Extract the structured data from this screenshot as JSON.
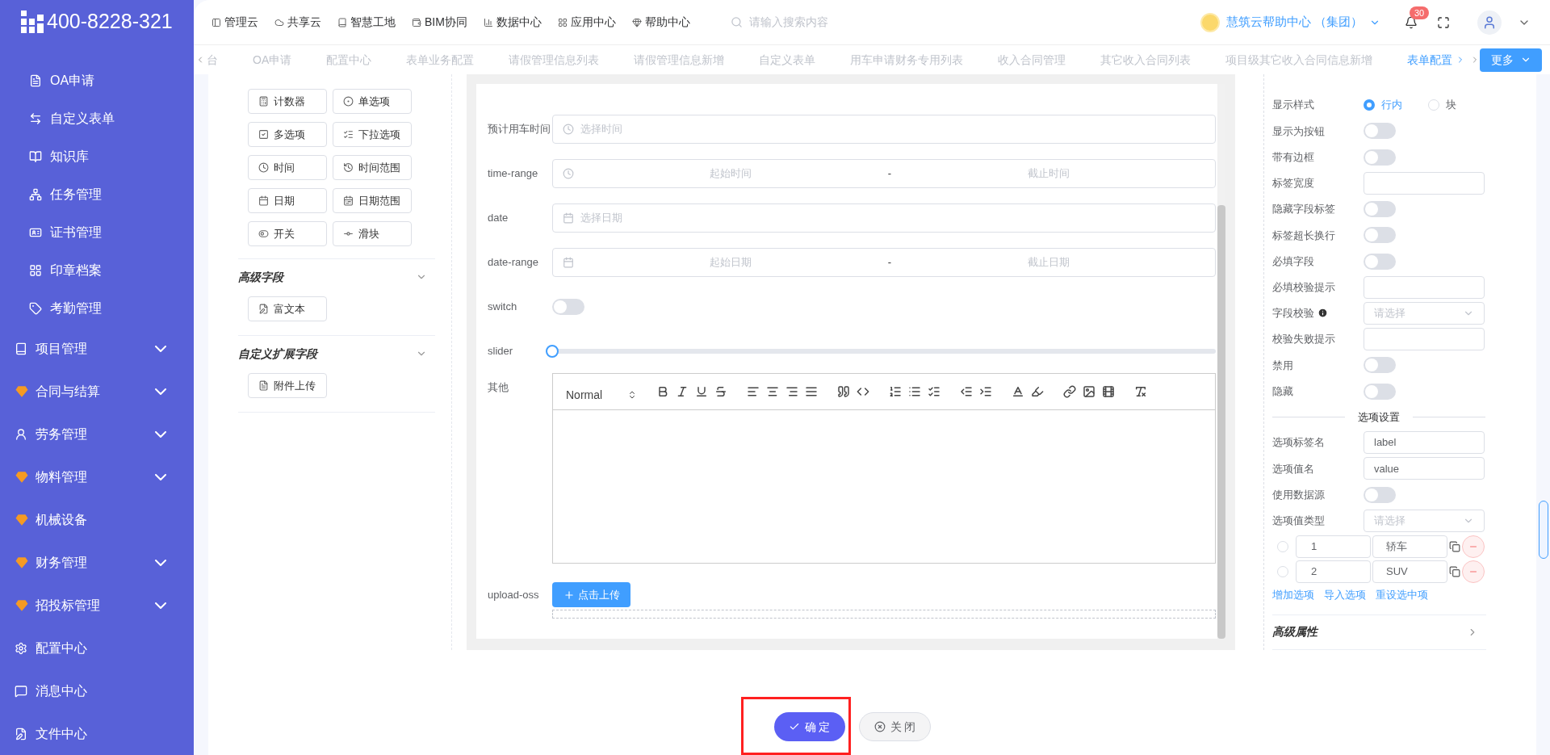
{
  "logo": {
    "text": "400-8228-321"
  },
  "sidebar": {
    "items": [
      {
        "label": "OA申请",
        "kind": "sub",
        "expandable": false
      },
      {
        "label": "自定义表单",
        "kind": "sub",
        "expandable": false
      },
      {
        "label": "知识库",
        "kind": "sub",
        "expandable": false
      },
      {
        "label": "任务管理",
        "kind": "sub",
        "expandable": false
      },
      {
        "label": "证书管理",
        "kind": "sub",
        "expandable": false
      },
      {
        "label": "印章档案",
        "kind": "sub",
        "expandable": false
      },
      {
        "label": "考勤管理",
        "kind": "sub",
        "expandable": false
      },
      {
        "label": "项目管理",
        "kind": "group",
        "expandable": true
      },
      {
        "label": "合同与结算",
        "kind": "group",
        "expandable": true
      },
      {
        "label": "劳务管理",
        "kind": "group",
        "expandable": true
      },
      {
        "label": "物料管理",
        "kind": "group",
        "expandable": true
      },
      {
        "label": "机械设备",
        "kind": "group",
        "expandable": false
      },
      {
        "label": "财务管理",
        "kind": "group",
        "expandable": true
      },
      {
        "label": "招投标管理",
        "kind": "group",
        "expandable": true
      },
      {
        "label": "配置中心",
        "kind": "group",
        "expandable": false
      },
      {
        "label": "消息中心",
        "kind": "group",
        "expandable": false
      },
      {
        "label": "文件中心",
        "kind": "group",
        "expandable": false
      }
    ]
  },
  "header": {
    "nav": [
      "管理云",
      "共享云",
      "智慧工地",
      "BIM协同",
      "数据中心",
      "应用中心",
      "帮助中心"
    ],
    "search": {
      "placeholder": "请输入搜索内容"
    },
    "org": "慧筑云帮助中心 （集团）",
    "notifications": "30"
  },
  "tabs": [
    {
      "label": "台",
      "selected": false
    },
    {
      "label": "OA申请",
      "selected": false
    },
    {
      "label": "配置中心",
      "selected": false
    },
    {
      "label": "表单业务配置",
      "selected": false
    },
    {
      "label": "请假管理信息列表",
      "selected": false
    },
    {
      "label": "请假管理信息新增",
      "selected": false
    },
    {
      "label": "自定义表单",
      "selected": false
    },
    {
      "label": "用车申请财务专用列表",
      "selected": false
    },
    {
      "label": "收入合同管理",
      "selected": false
    },
    {
      "label": "其它收入合同列表",
      "selected": false
    },
    {
      "label": "项目级其它收入合同信息新增",
      "selected": false
    },
    {
      "label": "表单配置",
      "selected": true
    }
  ],
  "more_button": "更多",
  "widgets": {
    "basic": [
      "计数器",
      "单选项",
      "多选项",
      "下拉选项",
      "时间",
      "时间范围",
      "日期",
      "日期范围",
      "开关",
      "滑块"
    ],
    "sections": [
      {
        "title": "高级字段",
        "expanded": true,
        "items": [
          "富文本"
        ]
      },
      {
        "title": "自定义扩展字段",
        "expanded": true,
        "items": [
          "附件上传"
        ]
      }
    ]
  },
  "form": {
    "fields": [
      {
        "label": "预计用车时间",
        "kind": "time",
        "placeholder": "选择时间"
      },
      {
        "label": "time-range",
        "kind": "timerange",
        "start": "起始时间",
        "separator": "-",
        "end": "截止时间"
      },
      {
        "label": "date",
        "kind": "date",
        "placeholder": "选择日期"
      },
      {
        "label": "date-range",
        "kind": "daterange",
        "start": "起始日期",
        "separator": "-",
        "end": "截止日期"
      },
      {
        "label": "switch",
        "kind": "switch",
        "on": false
      },
      {
        "label": "slider",
        "kind": "slider",
        "level": 0
      },
      {
        "label": "其他",
        "kind": "editor",
        "header": "Normal"
      },
      {
        "label": "upload-oss",
        "kind": "upload",
        "button": "点击上传"
      }
    ]
  },
  "properties": {
    "fields": [
      {
        "label": "显示样式",
        "kind": "radio",
        "options": [
          {
            "label": "行内",
            "selected": true
          },
          {
            "label": "块",
            "selected": false
          }
        ]
      },
      {
        "label": "显示为按钮",
        "kind": "switch",
        "on": false
      },
      {
        "label": "带有边框",
        "kind": "switch",
        "on": false
      },
      {
        "label": "标签宽度",
        "kind": "input"
      },
      {
        "label": "隐藏字段标签",
        "kind": "switch",
        "on": false
      },
      {
        "label": "标签超长换行",
        "kind": "switch",
        "on": false
      },
      {
        "label": "必填字段",
        "kind": "switch",
        "on": false
      },
      {
        "label": "必填校验提示",
        "kind": "input"
      },
      {
        "label": "字段校验",
        "kind": "select",
        "info": true,
        "placeholder": "请选择"
      },
      {
        "label": "校验失败提示",
        "kind": "input"
      },
      {
        "label": "禁用",
        "kind": "switch",
        "on": false
      },
      {
        "label": "隐藏",
        "kind": "switch",
        "on": false
      }
    ],
    "options_title": "选项设置",
    "option_fields": [
      {
        "label": "选项标签名",
        "kind": "input",
        "value": "label"
      },
      {
        "label": "选项值名",
        "kind": "input",
        "value": "value"
      },
      {
        "label": "使用数据源",
        "kind": "switch",
        "on": false
      },
      {
        "label": "选项值类型",
        "kind": "select",
        "placeholder": "请选择"
      }
    ],
    "options": [
      {
        "value": "1",
        "label": "轿车",
        "selected": false
      },
      {
        "value": "2",
        "label": "SUV",
        "selected": false
      }
    ],
    "links": [
      "增加选项",
      "导入选项",
      "重设选中项"
    ],
    "advanced": "高级属性"
  },
  "footer": {
    "buttons": [
      {
        "label": "确 定",
        "kind": "primary",
        "highlighted": true
      },
      {
        "label": "关 闭",
        "kind": "default",
        "highlighted": false
      }
    ]
  }
}
